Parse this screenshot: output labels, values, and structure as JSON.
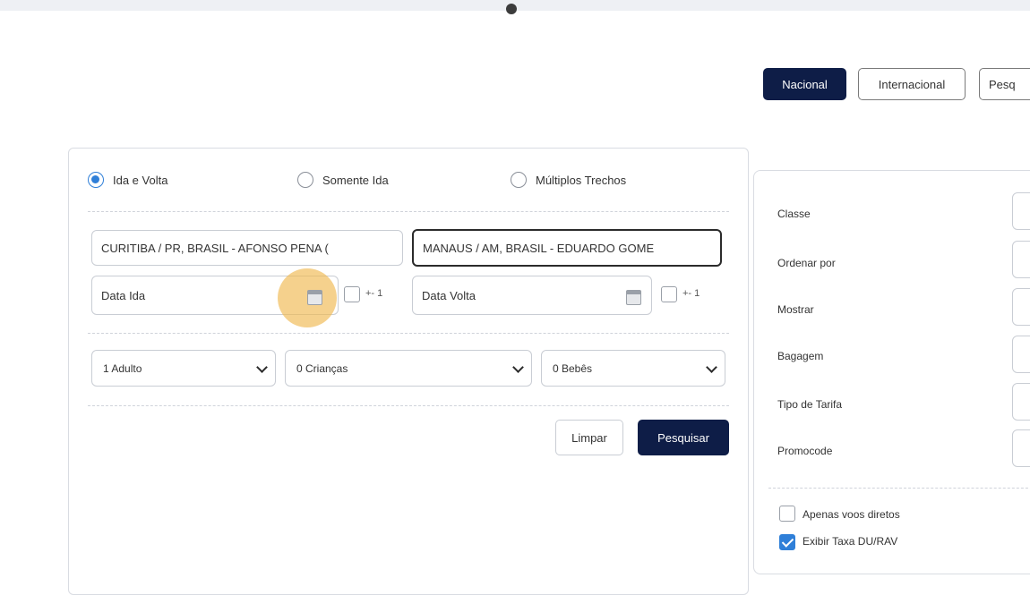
{
  "trip_mode_buttons": {
    "nacional": "Nacional",
    "internacional": "Internacional",
    "pesq": "Pesq"
  },
  "trip_type": {
    "options": [
      "Ida e Volta",
      "Somente Ida",
      "Múltiplos Trechos"
    ],
    "selected": "Ida e Volta"
  },
  "origin": {
    "value": "CURITIBA / PR, BRASIL  - AFONSO PENA ("
  },
  "destination": {
    "value": "MANAUS / AM, BRASIL  - EDUARDO GOME"
  },
  "dates": {
    "departure_placeholder": "Data Ida",
    "return_placeholder": "Data Volta",
    "plus_one_label": "+- 1"
  },
  "passengers": {
    "adults": "1 Adulto",
    "children": "0 Crianças",
    "infants": "0 Bebês"
  },
  "actions": {
    "clear": "Limpar",
    "search": "Pesquisar"
  },
  "options_panel": {
    "labels": [
      "Classe",
      "Ordenar por",
      "Mostrar",
      "Bagagem",
      "Tipo de Tarifa",
      "Promocode"
    ],
    "direct_flights_label": "Apenas voos diretos",
    "direct_flights_checked": false,
    "show_fee_label": "Exibir Taxa DU/RAV",
    "show_fee_checked": true
  },
  "colors": {
    "primary": "#0e1d47",
    "accent": "#2f7fd8",
    "highlight": "#f0b850"
  }
}
